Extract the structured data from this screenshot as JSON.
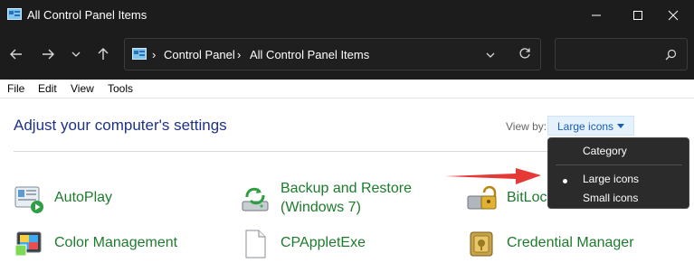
{
  "window": {
    "title": "All Control Panel Items"
  },
  "address": {
    "crumbs": [
      "Control Panel",
      "All Control Panel Items"
    ]
  },
  "menu": {
    "items": [
      "File",
      "Edit",
      "View",
      "Tools"
    ]
  },
  "content": {
    "heading": "Adjust your computer's settings",
    "view_by_label": "View by:",
    "view_by_value": "Large icons",
    "items": [
      {
        "label": "AutoPlay",
        "icon": "autoplay-icon"
      },
      {
        "label_line1": "Backup and Restore",
        "label_line2": "(Windows 7)",
        "icon": "backup-restore-icon"
      },
      {
        "label": "BitLocker Drive Encryption",
        "label_visible": "BitLoc",
        "icon": "bitlocker-icon"
      },
      {
        "label": "Color Management",
        "icon": "color-management-icon"
      },
      {
        "label": "CPAppletExe",
        "icon": "generic-file-icon"
      },
      {
        "label": "Credential Manager",
        "icon": "credential-manager-icon"
      }
    ]
  },
  "dropdown": {
    "options": [
      "Category",
      "Large icons",
      "Small icons"
    ],
    "selected": "Large icons"
  },
  "colors": {
    "title_bg": "#1c1c1c",
    "link_green": "#1d7b2c",
    "heading_blue": "#1e3287",
    "annotation_red": "#e53935"
  }
}
